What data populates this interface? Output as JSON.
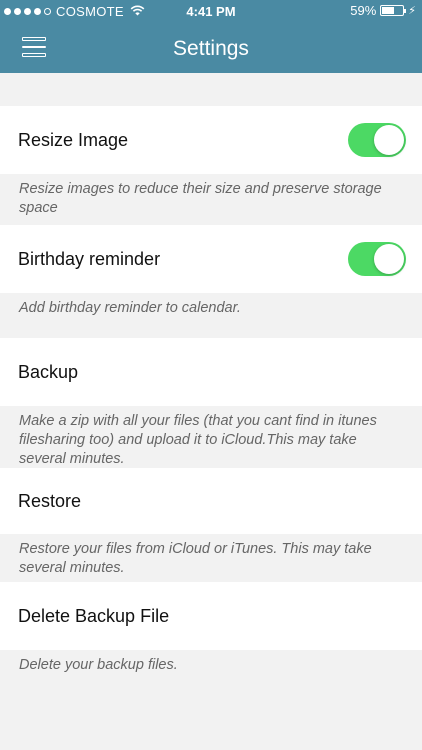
{
  "status_bar": {
    "carrier": "COSMOTE",
    "time": "4:41 PM",
    "battery": "59%",
    "battery_level": 0.59
  },
  "nav": {
    "title": "Settings"
  },
  "settings": {
    "resize_image": {
      "label": "Resize Image",
      "on": true,
      "description": "Resize images to reduce their size and preserve storage space"
    },
    "birthday_reminder": {
      "label": "Birthday reminder",
      "on": true,
      "description": "Add birthday reminder to calendar."
    },
    "backup": {
      "label": "Backup",
      "description": "Make a zip with all your files (that you cant find in itunes filesharing too) and upload it to iCloud.This may take several minutes."
    },
    "restore": {
      "label": "Restore",
      "description": "Restore your files from iCloud or iTunes. This may take several minutes."
    },
    "delete_backup": {
      "label": "Delete Backup File",
      "description": "Delete your backup files."
    }
  },
  "colors": {
    "nav_bar": "#4a8aa3",
    "switch_on": "#4cd964"
  },
  "icons": {
    "menu": "menu-icon",
    "wifi": "wifi-icon",
    "battery": "battery-icon",
    "charging": "charging-bolt-icon"
  }
}
